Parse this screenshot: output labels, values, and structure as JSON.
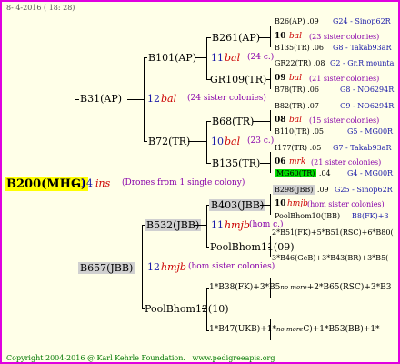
{
  "header": "8- 4-2016 ( 18: 28)",
  "footer": {
    "copyright": "Copyright 2004-2016 @ Karl Kehrle Foundation.",
    "url": "www.pedigreeapis.org"
  },
  "root": {
    "id": "B200(MHG)",
    "year": "14",
    "breeder": "ins",
    "note": "(Drones from 1 single colony)"
  },
  "gen1": {
    "upper": {
      "id": "B31(AP)",
      "year": "12",
      "breeder": "bal",
      "note": "(24 sister colonies)"
    },
    "lower": {
      "id": "B657(JBB)",
      "year": "12",
      "breeder": "hmjb",
      "note": "(hom sister colonies)"
    }
  },
  "gen2": {
    "a": {
      "id": "B101(AP)",
      "year": "11",
      "breeder": "bal",
      "note": "(24 c.)"
    },
    "b": {
      "id": "B72(TR)",
      "year": "10",
      "breeder": "bal",
      "note": "(23 c.)"
    },
    "c": {
      "id": "B532(JBB)",
      "year": "11",
      "breeder": "hmjb",
      "note": "(hom c.)"
    },
    "d": {
      "id": "PoolBhom12(10)"
    }
  },
  "gen3": {
    "a": {
      "id": "B261(AP)",
      "year": "10",
      "breeder": "bal",
      "note": "(23 sister colonies)"
    },
    "b": {
      "id": "GR109(TR)",
      "year": "09",
      "breeder": "bal",
      "note": "(21 sister colonies)"
    },
    "c": {
      "id": "B68(TR)",
      "year": "08",
      "breeder": "bal",
      "note": "(15 sister colonies)"
    },
    "d": {
      "id": "B135(TR)",
      "year": "06",
      "breeder": "mrk",
      "note": "(21 sister colonies)"
    },
    "e": {
      "id": "B403(JBB)",
      "year": "10",
      "breeder": "hmjb",
      "note": "(hom sister colonies)"
    },
    "f": {
      "id": "PoolBhom11(09)"
    },
    "g": {
      "id": "1*B38(FK)+3*B5",
      "sep": "no more",
      "rest": "+2*B65(RSC)+3*B3"
    },
    "h": {
      "id": "1*B47(UKB)+1*",
      "sep": "no more",
      "rest": "C)+1*B53(BB)+1*"
    }
  },
  "gen4": [
    {
      "id": "B26(AP)",
      "year": ".09",
      "drone": "G24 - Sinop62R"
    },
    {
      "id": "B135(TR)",
      "year": ".06",
      "drone": "G8 - Takab93aR"
    },
    {
      "id": "GR22(TR)",
      "year": ".08",
      "drone": "G2 - Gr.R.mounta"
    },
    {
      "id": "B78(TR)",
      "year": ".06",
      "drone": "G8 - NO6294R"
    },
    {
      "id": "B82(TR)",
      "year": ".07",
      "drone": "G9 - NO6294R"
    },
    {
      "id": "B110(TR)",
      "year": ".05",
      "drone": "G5 - MG00R"
    },
    {
      "id": "I177(TR)",
      "year": ".05",
      "drone": "G7 - Takab93aR"
    },
    {
      "id": "MG60(TR)",
      "year": ".04",
      "drone": "G4 - MG00R"
    },
    {
      "id": "B298(JBB)",
      "year": ".09",
      "drone": "G25 - Sinop62R"
    },
    {
      "id": "PoolBhom10(JBB)",
      "year": "",
      "drone": "B8(FK)+3"
    },
    {
      "id": "2*B51(FK)+5*B51(RSC)+6*B80("
    },
    {
      "id": "3*B46(GeB)+3*B43(BR)+3*B5("
    }
  ]
}
